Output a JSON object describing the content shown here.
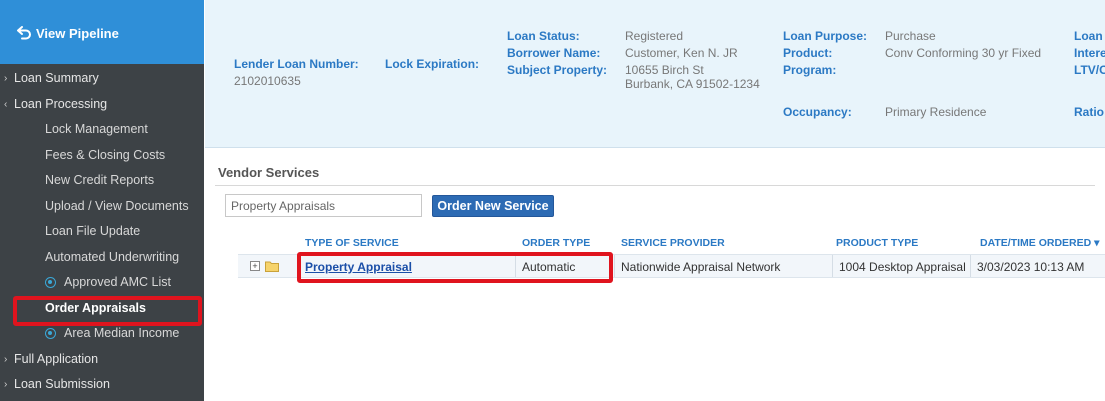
{
  "sidebar": {
    "view_pipeline": "View Pipeline",
    "items": [
      {
        "label": "Loan Summary",
        "level": "top",
        "arrow": "›"
      },
      {
        "label": "Loan Processing",
        "level": "top",
        "arrow": "‹"
      },
      {
        "label": "Lock Management",
        "level": "sub"
      },
      {
        "label": "Fees & Closing Costs",
        "level": "sub"
      },
      {
        "label": "New Credit Reports",
        "level": "sub"
      },
      {
        "label": "Upload / View Documents",
        "level": "sub"
      },
      {
        "label": "Loan File Update",
        "level": "sub"
      },
      {
        "label": "Automated Underwriting",
        "level": "sub"
      },
      {
        "label": "Approved AMC List",
        "level": "subicon"
      },
      {
        "label": "Order Appraisals",
        "level": "sub",
        "active": true
      },
      {
        "label": "Area Median Income",
        "level": "subicon"
      },
      {
        "label": "Full Application",
        "level": "top",
        "arrow": "›"
      },
      {
        "label": "Loan Submission",
        "level": "top",
        "arrow": "›"
      }
    ]
  },
  "header": {
    "lender_loan_number_label": "Lender Loan Number:",
    "lender_loan_number": "2102010635",
    "lock_expiration_label": "Lock Expiration:",
    "loan_status_label": "Loan Status:",
    "loan_status": "Registered",
    "borrower_name_label": "Borrower Name:",
    "borrower_name": "Customer, Ken N. JR",
    "subject_property_label": "Subject Property:",
    "subject_property_line1": "10655 Birch St",
    "subject_property_line2": "Burbank, CA 91502-1234",
    "loan_purpose_label": "Loan Purpose:",
    "loan_purpose": "Purchase",
    "product_label": "Product:",
    "product": "Conv Conforming 30 yr Fixed",
    "program_label": "Program:",
    "occupancy_label": "Occupancy:",
    "occupancy": "Primary Residence",
    "cut_label_1": "Loan",
    "cut_label_2": "Intere",
    "cut_label_3": "LTV/C",
    "cut_label_4": "Ratio"
  },
  "vendor_services": {
    "title": "Vendor Services",
    "service_select_value": "Property Appraisals",
    "order_button": "Order New Service",
    "columns": {
      "type_of_service": "TYPE OF SERVICE",
      "order_type": "ORDER TYPE",
      "service_provider": "SERVICE PROVIDER",
      "product_type": "PRODUCT TYPE",
      "date_time_ordered": "DATE/TIME ORDERED ▾"
    },
    "row": {
      "type_of_service": "Property Appraisal",
      "order_type": "Automatic",
      "service_provider": "Nationwide Appraisal Network",
      "product_type": "1004 Desktop Appraisal",
      "date_time_ordered": "3/03/2023 10:13 AM"
    }
  },
  "colors": {
    "sidebar_bg": "#3d4246",
    "pipeline_bg": "#2f8fd8",
    "header_bg": "#e8f4fb",
    "label_blue": "#2b79c4",
    "highlight_red": "#e0141e",
    "button_blue": "#2d6bb4"
  }
}
